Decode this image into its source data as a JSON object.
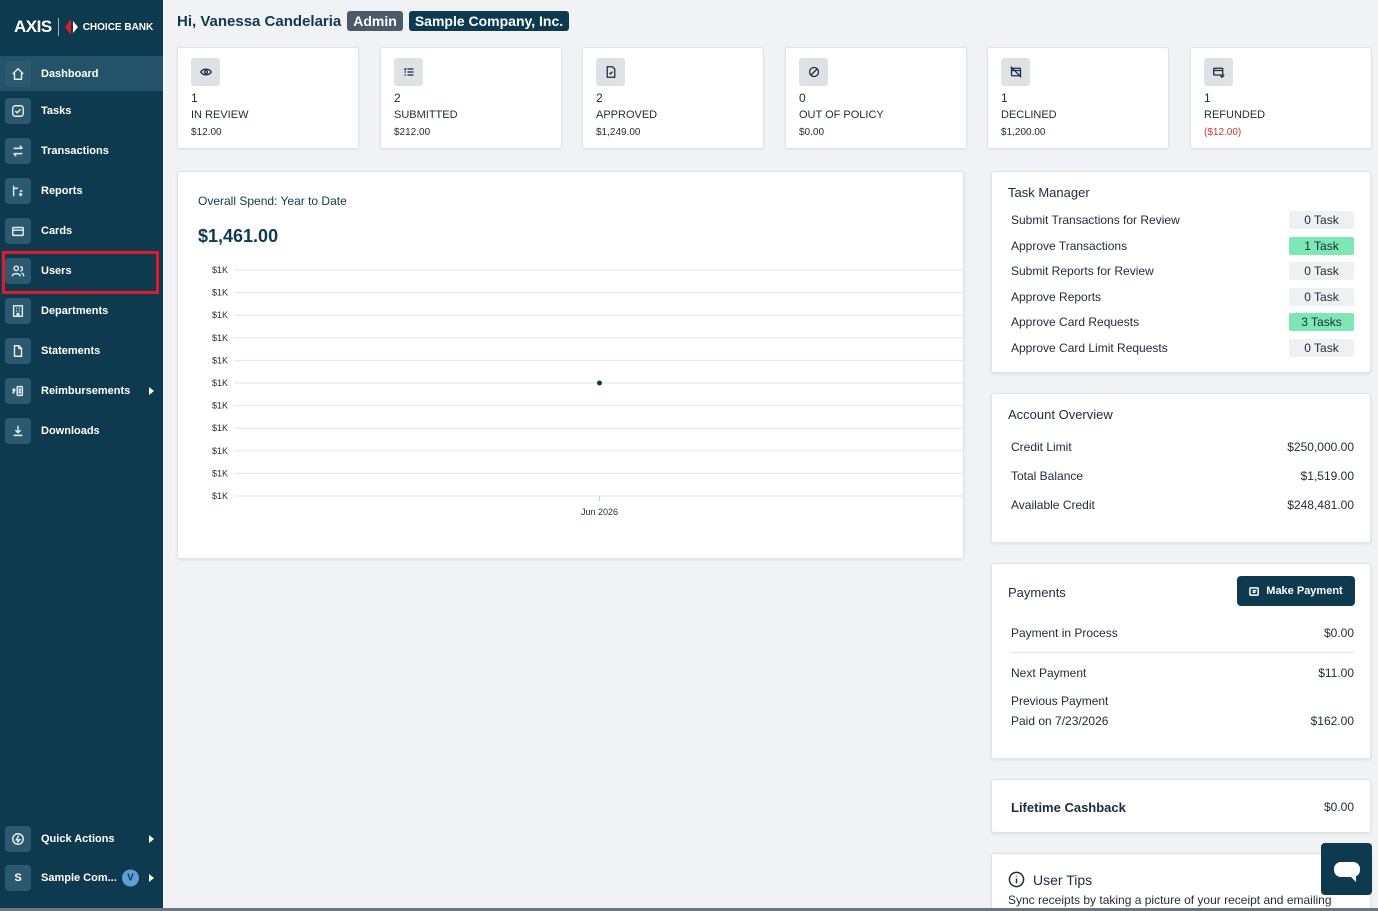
{
  "brand": {
    "axis": "AXIS",
    "bank": "CHOICE BANK"
  },
  "sidebar": {
    "items": [
      {
        "label": "Dashboard",
        "icon": "home-icon"
      },
      {
        "label": "Tasks",
        "icon": "check-circle-icon"
      },
      {
        "label": "Transactions",
        "icon": "arrows-swap-icon"
      },
      {
        "label": "Reports",
        "icon": "report-icon"
      },
      {
        "label": "Cards",
        "icon": "card-icon"
      },
      {
        "label": "Users",
        "icon": "users-icon"
      },
      {
        "label": "Departments",
        "icon": "building-icon"
      },
      {
        "label": "Statements",
        "icon": "document-icon"
      },
      {
        "label": "Reimbursements",
        "icon": "money-icon"
      },
      {
        "label": "Downloads",
        "icon": "download-icon"
      }
    ],
    "bottom": {
      "quick_actions": "Quick Actions",
      "company_short": "Sample Com...",
      "company_initial": "S",
      "user_initial": "V"
    }
  },
  "header": {
    "greeting": "Hi, Vanessa Candelaria",
    "role": "Admin",
    "company": "Sample Company, Inc."
  },
  "stats": [
    {
      "count": "1",
      "label": "IN REVIEW",
      "amount": "$12.00",
      "icon": "eye-icon"
    },
    {
      "count": "2",
      "label": "SUBMITTED",
      "amount": "$212.00",
      "icon": "list-check-icon"
    },
    {
      "count": "2",
      "label": "APPROVED",
      "amount": "$1,249.00",
      "icon": "file-check-icon"
    },
    {
      "count": "0",
      "label": "OUT OF POLICY",
      "amount": "$0.00",
      "icon": "ban-icon"
    },
    {
      "count": "1",
      "label": "DECLINED",
      "amount": "$1,200.00",
      "icon": "card-off-icon"
    },
    {
      "count": "1",
      "label": "REFUNDED",
      "amount": "($12.00)",
      "icon": "card-refund-icon"
    }
  ],
  "chart": {
    "title": "Overall Spend: Year to Date",
    "total": "$1,461.00"
  },
  "chart_data": {
    "type": "line",
    "title": "Overall Spend: Year to Date",
    "x": [
      "Jun 2026"
    ],
    "series": [
      {
        "values": [
          1461
        ]
      }
    ],
    "y_tick_labels": [
      "$1K",
      "$1K",
      "$1K",
      "$1K",
      "$1K",
      "$1K",
      "$1K",
      "$1K",
      "$1K",
      "$1K",
      "$1K"
    ],
    "grid": true,
    "point_color": "#0d3a4f"
  },
  "task_manager": {
    "title": "Task Manager",
    "rows": [
      {
        "label": "Submit Transactions for Review",
        "badge": "0 Task",
        "highlight": false
      },
      {
        "label": "Approve Transactions",
        "badge": "1 Task",
        "highlight": true
      },
      {
        "label": "Submit Reports for Review",
        "badge": "0 Task",
        "highlight": false
      },
      {
        "label": "Approve Reports",
        "badge": "0 Task",
        "highlight": false
      },
      {
        "label": "Approve Card Requests",
        "badge": "3 Tasks",
        "highlight": true
      },
      {
        "label": "Approve Card Limit Requests",
        "badge": "0 Task",
        "highlight": false
      }
    ]
  },
  "account_overview": {
    "title": "Account Overview",
    "rows": [
      {
        "label": "Credit Limit",
        "value": "$250,000.00"
      },
      {
        "label": "Total Balance",
        "value": "$1,519.00"
      },
      {
        "label": "Available Credit",
        "value": "$248,481.00"
      }
    ]
  },
  "payments": {
    "title": "Payments",
    "button": "Make Payment",
    "in_process_label": "Payment in Process",
    "in_process_value": "$0.00",
    "next_label": "Next Payment",
    "next_value": "$11.00",
    "previous_label": "Previous Payment",
    "previous_sub": "Paid on 7/23/2026",
    "previous_value": "$162.00"
  },
  "cashback": {
    "label": "Lifetime Cashback",
    "value": "$0.00"
  },
  "tips": {
    "title": "User Tips",
    "text": "Sync receipts by taking a picture of your receipt and emailing"
  },
  "colors": {
    "sidebar": "#0d3a4f",
    "accent_green": "#7de8b3",
    "negative": "#c0392b",
    "highlight": "#e0192d"
  }
}
